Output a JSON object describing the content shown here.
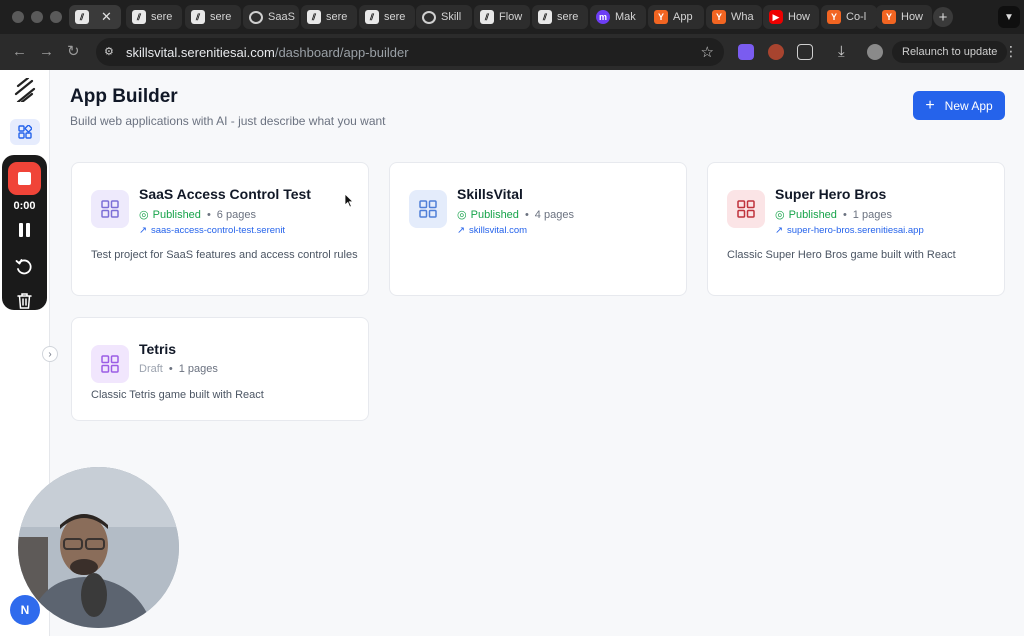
{
  "browser": {
    "tabs": [
      {
        "title": "",
        "icon": "serenity-logo",
        "active": true
      },
      {
        "title": "sere",
        "icon": "serenity-logo"
      },
      {
        "title": "sere",
        "icon": "serenity-logo"
      },
      {
        "title": "SaaS",
        "icon": "globe"
      },
      {
        "title": "sere",
        "icon": "serenity-logo"
      },
      {
        "title": "sere",
        "icon": "serenity-logo"
      },
      {
        "title": "Skill",
        "icon": "globe"
      },
      {
        "title": "Flow",
        "icon": "serenity-logo"
      },
      {
        "title": "sere",
        "icon": "serenity-logo"
      },
      {
        "title": "Mak",
        "icon": "m-logo"
      },
      {
        "title": "App",
        "icon": "y-logo"
      },
      {
        "title": "Wha",
        "icon": "y-logo"
      },
      {
        "title": "How",
        "icon": "youtube"
      },
      {
        "title": "Co-l",
        "icon": "y-logo"
      },
      {
        "title": "How",
        "icon": "y-logo"
      }
    ],
    "url_host": "skillsvital.serenitiesai.com",
    "url_path": "/dashboard/app-builder",
    "relaunch_label": "Relaunch to update"
  },
  "sidebar": {
    "avatar_initial": "N"
  },
  "recorder": {
    "time": "0:00"
  },
  "header": {
    "title": "App Builder",
    "subtitle": "Build web applications with AI - just describe what you want",
    "new_app_label": "New App"
  },
  "apps": [
    {
      "name": "SaaS Access Control Test",
      "status": "Published",
      "pages": "6 pages",
      "link": "saas-access-control-test.serenit",
      "description": "Test project for SaaS features and access control rules",
      "color": "#7c6fd6"
    },
    {
      "name": "SkillsVital",
      "status": "Published",
      "pages": "4 pages",
      "link": "skillsvital.com",
      "description": "",
      "color": "#4f7fd8"
    },
    {
      "name": "Super Hero Bros",
      "status": "Published",
      "pages": "1 pages",
      "link": "super-hero-bros.serenitiesai.app",
      "description": "Classic Super Hero Bros game built with React",
      "color": "#c0323c"
    },
    {
      "name": "Tetris",
      "status": "Draft",
      "pages": "1 pages",
      "link": "",
      "description": "Classic Tetris game built with React",
      "color": "#9b5de5"
    }
  ],
  "colors": {
    "primary": "#2563eb",
    "published": "#16a34a",
    "record": "#f04438"
  }
}
